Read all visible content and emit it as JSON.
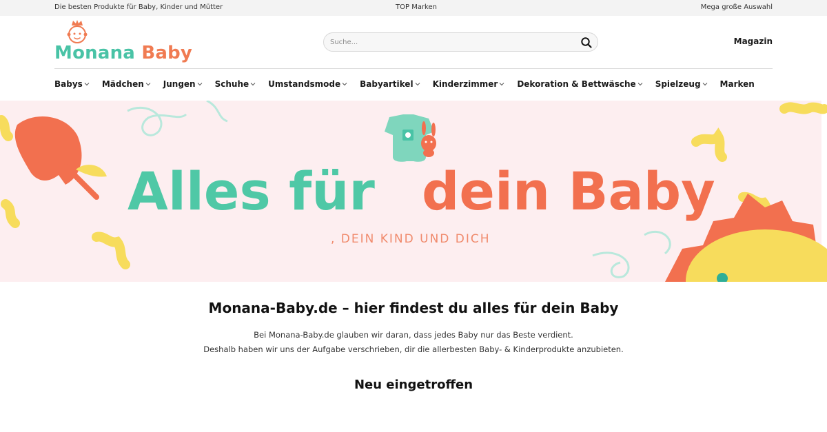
{
  "topbar": {
    "left_text": "Die besten Produkte für Baby, Kinder und Mütter",
    "center_text": "TOP Marken",
    "right_text": "Mega große Auswahl"
  },
  "logo": {
    "word1": "Monana",
    "word2": "Baby",
    "icon": "baby-face-icon",
    "colors": {
      "primary": "#49c3a6",
      "accent": "#f07b52"
    }
  },
  "search": {
    "placeholder": "Suche...",
    "icon": "search-icon"
  },
  "header": {
    "magazin_label": "Magazin"
  },
  "nav": {
    "items": [
      {
        "label": "Babys",
        "has_dropdown": true
      },
      {
        "label": "Mädchen",
        "has_dropdown": true
      },
      {
        "label": "Jungen",
        "has_dropdown": true
      },
      {
        "label": "Schuhe",
        "has_dropdown": true
      },
      {
        "label": "Umstandsmode",
        "has_dropdown": true
      },
      {
        "label": "Babyartikel",
        "has_dropdown": true
      },
      {
        "label": "Kinderzimmer",
        "has_dropdown": true
      },
      {
        "label": "Dekoration & Bettwäsche",
        "has_dropdown": true
      },
      {
        "label": "Spielzeug",
        "has_dropdown": true
      },
      {
        "label": "Marken",
        "has_dropdown": false
      }
    ]
  },
  "hero": {
    "headline_part1": "Alles für",
    "headline_part2": "dein Baby",
    "subline": ", DEIN KIND UND DICH",
    "colors": {
      "background": "#fdeef0",
      "green": "#4fc8a6",
      "orange": "#f2704f",
      "yellow": "#f7dc5c"
    }
  },
  "intro": {
    "title": "Monana-Baby.de – hier findest du alles für dein Baby",
    "line1": "Bei Monana-Baby.de glauben wir daran, dass jedes Baby nur das Beste verdient.",
    "line2": "Deshalb haben wir uns der Aufgabe verschrieben, dir die allerbesten Baby- & Kinderprodukte anzubieten."
  },
  "new_arrivals": {
    "title": "Neu eingetroffen"
  }
}
